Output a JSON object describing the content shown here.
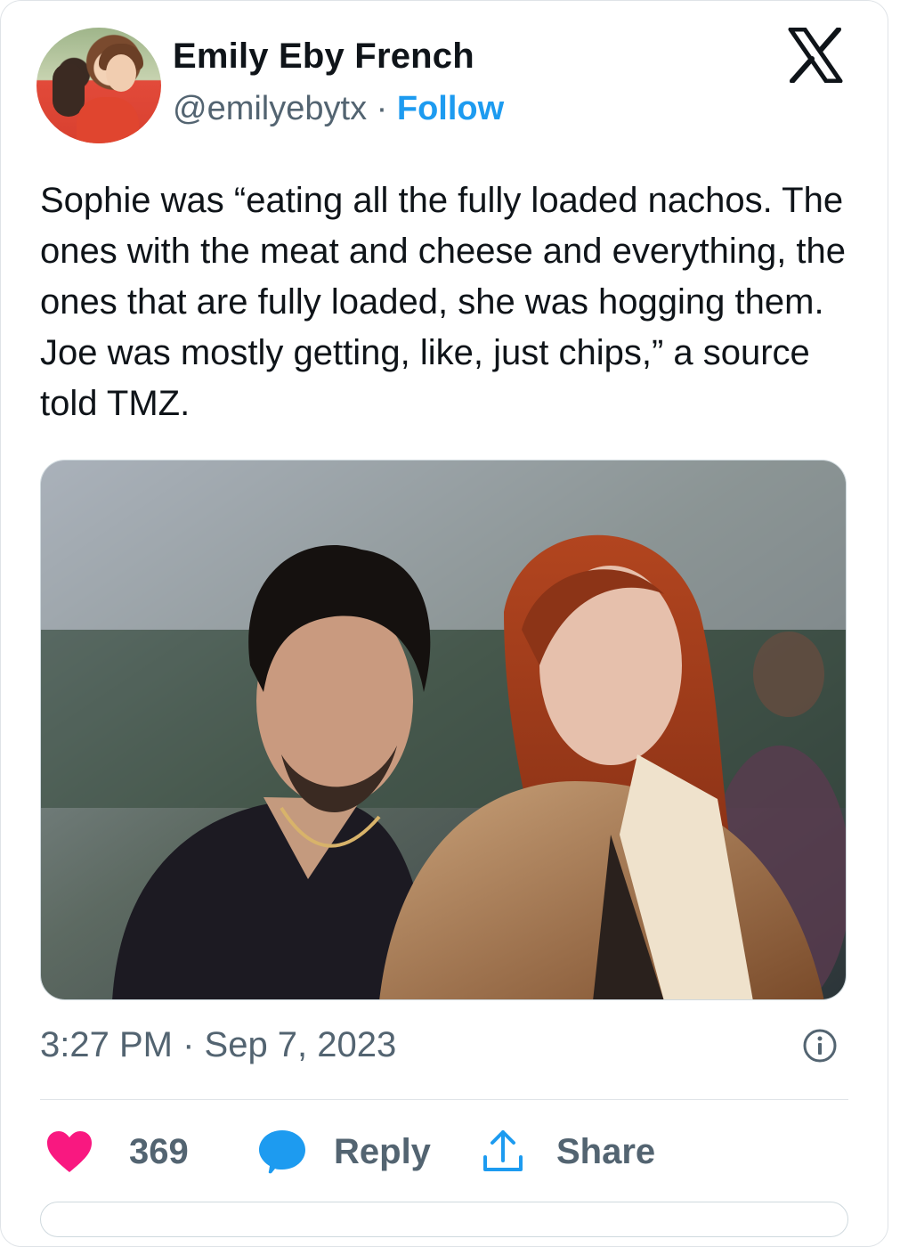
{
  "author": {
    "name": "Emily Eby French",
    "handle": "@emilyebytx",
    "separator": "·",
    "follow_label": "Follow"
  },
  "tweet": {
    "text": "Sophie was “eating all the fully loaded nachos. The ones with the meat and cheese and everything, the ones that are fully loaded, she was hogging them. Joe was mostly getting, like, just chips,” a source told TMZ."
  },
  "meta": {
    "timestamp": "3:27 PM · Sep 7, 2023"
  },
  "actions": {
    "like_count": "369",
    "reply_label": "Reply",
    "share_label": "Share"
  },
  "icons": {
    "platform": "x-logo-icon",
    "info": "info-icon",
    "like": "heart-icon",
    "reply": "speech-bubble-icon",
    "share": "share-arrow-icon"
  },
  "colors": {
    "follow_blue": "#1d9bf0",
    "like_pink": "#f91880",
    "reply_blue": "#1d9bf0",
    "secondary_text": "#536471",
    "primary_text": "#0f1419"
  }
}
